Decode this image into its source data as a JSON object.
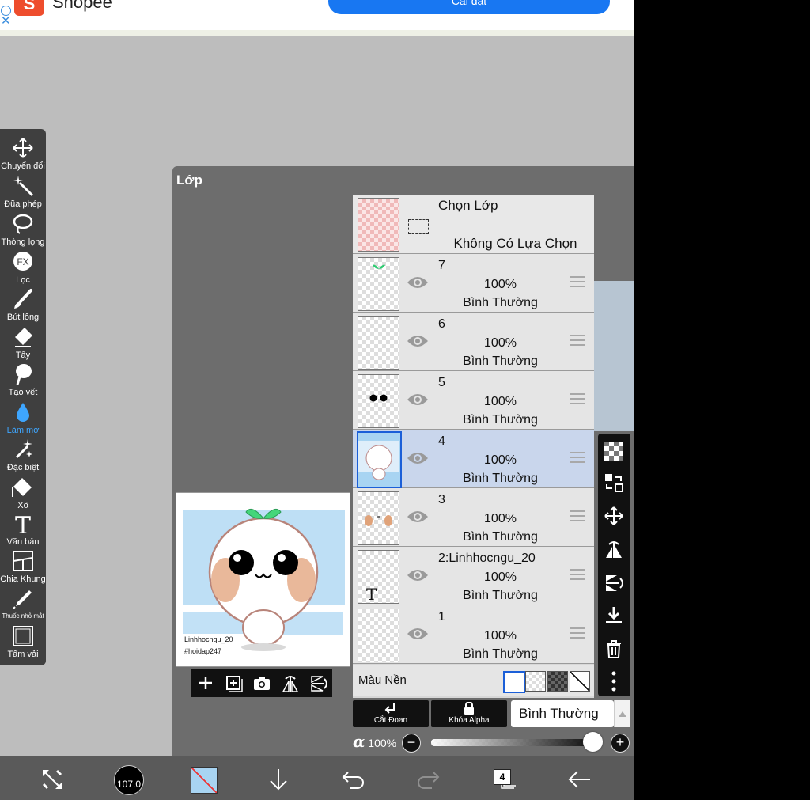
{
  "ad": {
    "name": "Shopee",
    "logo_letter": "S",
    "button": "Cài đặt",
    "info": "i",
    "close": "✕"
  },
  "tools": [
    {
      "label": "Chuyển đổi",
      "icon": "move-icon"
    },
    {
      "label": "Đũa phép",
      "icon": "magic-wand-icon"
    },
    {
      "label": "Thòng lọng",
      "icon": "lasso-icon"
    },
    {
      "label": "Lọc",
      "icon": "fx-icon",
      "badge": "FX"
    },
    {
      "label": "Bút lông",
      "icon": "brush-icon"
    },
    {
      "label": "Tẩy",
      "icon": "eraser-icon"
    },
    {
      "label": "Tạo vết",
      "icon": "smudge-icon"
    },
    {
      "label": "Làm mờ",
      "icon": "blur-drop-icon",
      "active": true
    },
    {
      "label": "Đặc biệt",
      "icon": "special-icon"
    },
    {
      "label": "Xô",
      "icon": "bucket-icon"
    },
    {
      "label": "Văn bản",
      "icon": "text-icon",
      "badge": "T"
    },
    {
      "label": "Chia Khung",
      "icon": "frame-divider-icon"
    },
    {
      "label": "Thuốc nhỏ mắt",
      "icon": "eyedropper-icon"
    },
    {
      "label": "Tấm vải",
      "icon": "canvas-icon"
    }
  ],
  "panel": {
    "title": "Lớp",
    "selection": {
      "title": "Chọn Lớp",
      "subtitle": "Không Có Lựa Chọn"
    },
    "layers": [
      {
        "name": "7",
        "opacity": "100%",
        "mode": "Bình Thường"
      },
      {
        "name": "6",
        "opacity": "100%",
        "mode": "Bình Thường"
      },
      {
        "name": "5",
        "opacity": "100%",
        "mode": "Bình Thường"
      },
      {
        "name": "4",
        "opacity": "100%",
        "mode": "Bình Thường",
        "selected": true
      },
      {
        "name": "3",
        "opacity": "100%",
        "mode": "Bình Thường"
      },
      {
        "name": "2:Linhhocngu_20",
        "opacity": "100%",
        "mode": "Bình Thường"
      },
      {
        "name": "1",
        "opacity": "100%",
        "mode": "Bình Thường"
      }
    ],
    "background_label": "Màu Nền",
    "clip_label": "Cắt Đoan",
    "alpha_lock_label": "Khóa Alpha",
    "blend_mode": "Bình Thường",
    "alpha_symbol": "α",
    "opacity_value": "100%",
    "opacity_level": 1.0,
    "minus": "−",
    "plus": "+",
    "thumb_text_letter": "T"
  },
  "preview": {
    "watermark_line1": "Linhhocngu_20",
    "watermark_line2": "#hoidap247"
  },
  "bottom": {
    "brush_size": "107.0",
    "layer_count": "4"
  },
  "colors": {
    "accent": "#3ea6ff",
    "selected_row": "#c9d6ec",
    "panel": "#6d6d6d",
    "toolbar": "#3f3f3f"
  }
}
